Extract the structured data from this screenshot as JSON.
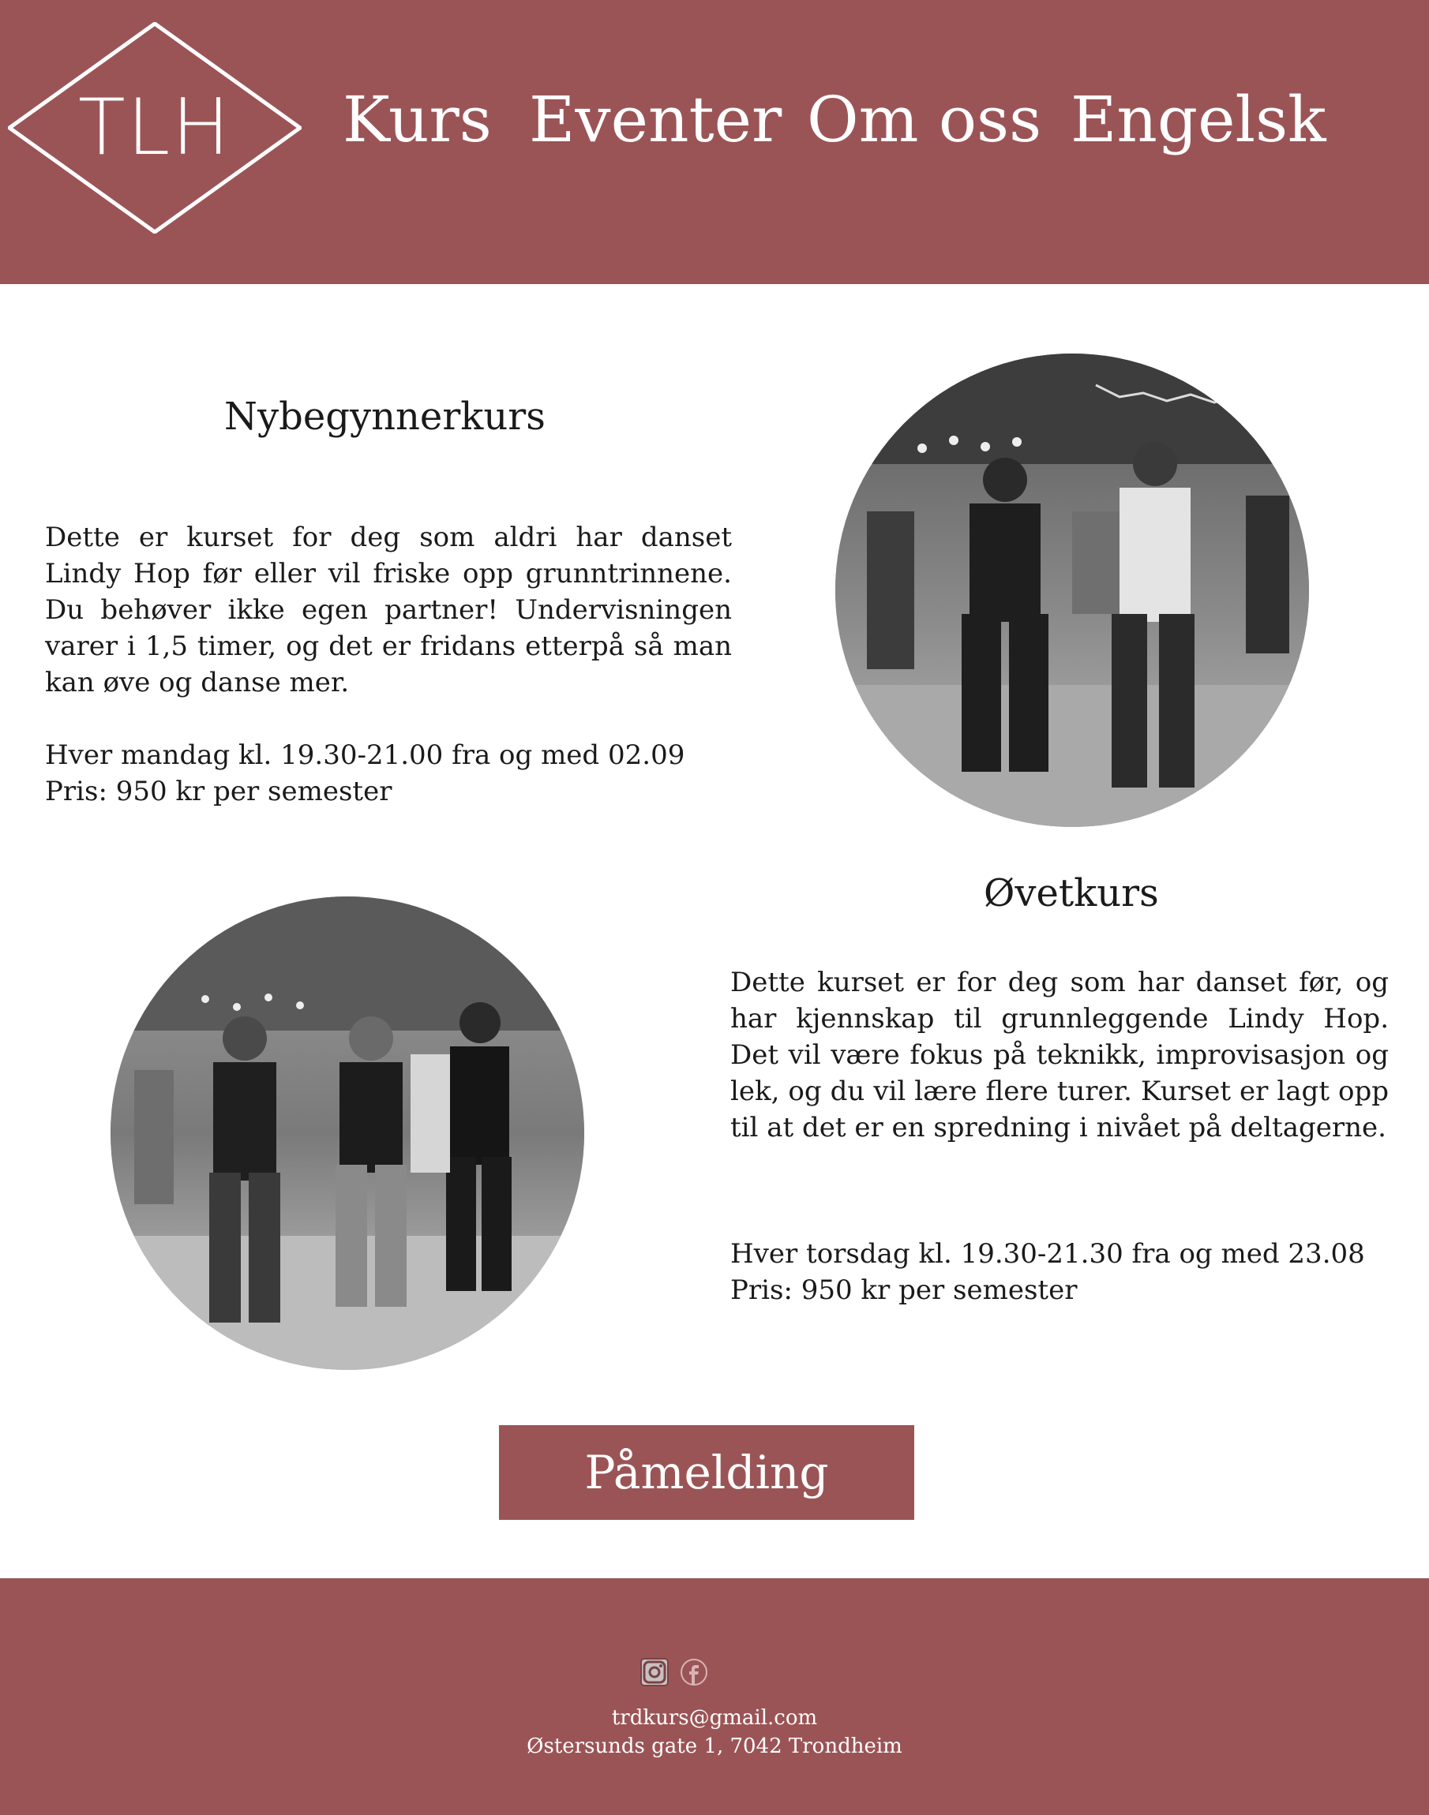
{
  "header": {
    "logo_text": "TLH",
    "nav": [
      {
        "label": "Kurs"
      },
      {
        "label": "Eventer"
      },
      {
        "label": "Om oss"
      },
      {
        "label": "Engelsk"
      }
    ]
  },
  "courses": [
    {
      "title": "Nybegynnerkurs",
      "description": "Dette er kurset for deg som aldri har danset Lindy Hop før eller vil friske opp grunntrinnene. Du behøver ikke egen partner! Undervisningen varer i 1,5 timer, og det er fridans etterpå så man kan øve og danse mer.",
      "schedule": "Hver mandag kl. 19.30-21.00  fra og med 02.09",
      "price": "Pris: 950 kr per semester"
    },
    {
      "title": "Øvetkurs",
      "description": "Dette kurset er for deg som har danset før, og har kjennskap til grunnleggende Lindy Hop. Det vil være fokus på teknikk, improvisasjon og lek, og du vil lære flere turer. Kurset er lagt opp til at det er en spredning i nivået på deltagerne.",
      "schedule": "Hver torsdag kl. 19.30-21.30 fra og med 23.08",
      "price": "Pris: 950 kr per semester"
    }
  ],
  "cta": {
    "label": "Påmelding"
  },
  "footer": {
    "icons": [
      "instagram-icon",
      "facebook-icon"
    ],
    "email": "trdkurs@gmail.com",
    "address": "Østersunds gate 1, 7042 Trondheim"
  },
  "colors": {
    "brand": "#9b5456",
    "text": "#1a1a1a",
    "background": "#ffffff"
  }
}
